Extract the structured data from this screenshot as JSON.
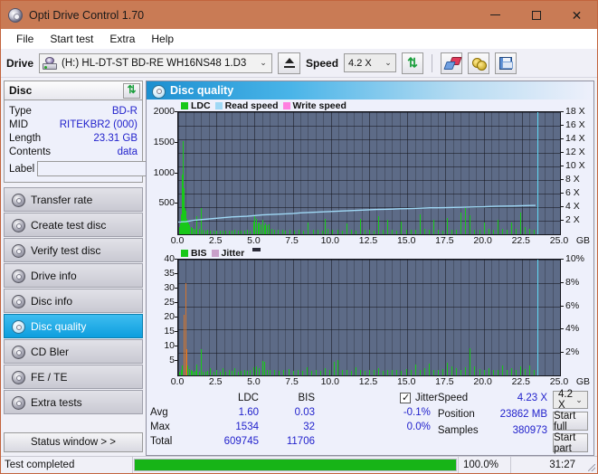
{
  "window": {
    "title": "Opti Drive Control 1.70",
    "icon": "disc-icon",
    "minimize": "minimize-icon",
    "maximize": "maximize-icon",
    "close": "close-icon"
  },
  "menu": [
    "File",
    "Start test",
    "Extra",
    "Help"
  ],
  "toolbar": {
    "drive_label": "Drive",
    "drive_value": "(H:)  HL-DT-ST BD-RE  WH16NS48 1.D3",
    "eject": "eject-icon",
    "speed_label": "Speed",
    "speed_value": "4.2 X",
    "refresh": "refresh-icon",
    "erase": "eraser-icon",
    "tools": "tools-icon",
    "save": "save-icon"
  },
  "disc_panel": {
    "header": "Disc",
    "refresh": "refresh-icon",
    "rows": [
      {
        "key": "Type",
        "value": "BD-R"
      },
      {
        "key": "MID",
        "value": "RITEKBR2 (000)"
      },
      {
        "key": "Length",
        "value": "23.31 GB"
      },
      {
        "key": "Contents",
        "value": "data"
      }
    ],
    "label_key": "Label",
    "label_value": "",
    "label_btn": "cd-icon"
  },
  "sidebar": {
    "items": [
      {
        "label": "Transfer rate",
        "active": false
      },
      {
        "label": "Create test disc",
        "active": false
      },
      {
        "label": "Verify test disc",
        "active": false
      },
      {
        "label": "Drive info",
        "active": false
      },
      {
        "label": "Disc info",
        "active": false
      },
      {
        "label": "Disc quality",
        "active": true
      },
      {
        "label": "CD Bler",
        "active": false
      },
      {
        "label": "FE / TE",
        "active": false
      },
      {
        "label": "Extra tests",
        "active": false
      }
    ],
    "status_window": "Status window > >"
  },
  "main": {
    "title": "Disc quality",
    "icon": "disc-quality-icon"
  },
  "stats": {
    "col_headers": [
      "LDC",
      "BIS"
    ],
    "rows": [
      {
        "label": "Avg",
        "ldc": "1.60",
        "bis": "0.03"
      },
      {
        "label": "Max",
        "ldc": "1534",
        "bis": "32"
      },
      {
        "label": "Total",
        "ldc": "609745",
        "bis": "11706"
      }
    ],
    "jitter_label": "Jitter",
    "jitter_checked": true,
    "jitter_avg": "-0.1%",
    "jitter_max": "0.0%",
    "speed_label": "Speed",
    "speed_value": "4.23 X",
    "position_label": "Position",
    "position_value": "23862 MB",
    "samples_label": "Samples",
    "samples_value": "380973",
    "speed_select": "4.2 X",
    "start_full": "Start full",
    "start_part": "Start part"
  },
  "statusbar": {
    "message": "Test completed",
    "percent": "100.0%",
    "percent_value": 100,
    "time": "31:27"
  },
  "colors": {
    "titlebar": "#c97b55",
    "accent": "#0d9ede",
    "ldc_green": "#18c818",
    "read_speed": "#9fd8f5",
    "write_speed": "#ff7fe0",
    "jitter": "#c9a0c9",
    "value_blue": "#2222cc",
    "progress_green": "#17b417",
    "plot_bg": "#5d6b87"
  },
  "chart_data": [
    {
      "id": "ldc-chart",
      "type": "bar",
      "title": "Disc quality",
      "legend": [
        {
          "label": "LDC",
          "color": "#18c818"
        },
        {
          "label": "Read speed",
          "color": "#9fd8f5"
        },
        {
          "label": "Write speed",
          "color": "#ff7fe0"
        }
      ],
      "legend_position": "top-left",
      "xlabel": "GB",
      "ylabel": "LDC",
      "y2label": "X",
      "xlim": [
        0,
        25.0
      ],
      "ylim": [
        0,
        2000
      ],
      "y2lim": [
        0,
        18
      ],
      "xticks": [
        0.0,
        2.5,
        5.0,
        7.5,
        10.0,
        12.5,
        15.0,
        17.5,
        20.0,
        22.5,
        25.0
      ],
      "xtick_labels": [
        "0.0",
        "2.5",
        "5.0",
        "7.5",
        "10.0",
        "12.5",
        "15.0",
        "17.5",
        "20.0",
        "22.5",
        "25.0"
      ],
      "yticks": [
        500,
        1000,
        1500,
        2000
      ],
      "ytick_labels": [
        "500",
        "1000",
        "1500",
        "2000"
      ],
      "y2ticks": [
        2,
        4,
        6,
        8,
        10,
        12,
        14,
        16,
        18
      ],
      "y2tick_labels": [
        "2 X",
        "4 X",
        "6 X",
        "8 X",
        "10 X",
        "12 X",
        "14 X",
        "16 X",
        "18 X"
      ],
      "grid": true,
      "cursor_x": 23.5,
      "series": [
        {
          "name": "LDC",
          "color": "#18c818",
          "type": "bar",
          "x": [
            0.05,
            0.1,
            0.15,
            0.2,
            0.25,
            0.3,
            0.35,
            0.4,
            0.45,
            0.5,
            0.55,
            0.6,
            0.65,
            0.7,
            0.8,
            0.9,
            1.0,
            1.1,
            1.2,
            1.35,
            1.5,
            1.6,
            1.75,
            1.9,
            2.1,
            2.3,
            2.5,
            2.7,
            2.9,
            3.1,
            3.3,
            3.5,
            3.7,
            3.9,
            4.1,
            4.3,
            4.5,
            4.7,
            4.9,
            5.0,
            5.1,
            5.2,
            5.3,
            5.4,
            5.5,
            5.6,
            5.7,
            5.8,
            5.9,
            6.1,
            6.3,
            6.5,
            6.8,
            7.0,
            7.3,
            7.6,
            7.9,
            8.2,
            8.5,
            8.8,
            9.1,
            9.4,
            9.6,
            9.8,
            10.1,
            10.4,
            10.7,
            11.0,
            11.3,
            11.6,
            11.9,
            12.2,
            12.5,
            12.8,
            13.1,
            13.4,
            13.7,
            14.0,
            14.3,
            14.6,
            14.9,
            15.2,
            15.5,
            15.8,
            16.1,
            16.4,
            16.7,
            17.0,
            17.3,
            17.6,
            17.9,
            18.2,
            18.5,
            18.8,
            19.1,
            19.4,
            19.7,
            20.0,
            20.3,
            20.6,
            20.9,
            21.2,
            21.5,
            21.8,
            22.1,
            22.4,
            22.7,
            23.0,
            23.3
          ],
          "values": [
            120,
            180,
            260,
            330,
            980,
            1534,
            760,
            430,
            390,
            330,
            260,
            210,
            180,
            150,
            130,
            110,
            90,
            85,
            300,
            95,
            430,
            80,
            70,
            75,
            70,
            65,
            70,
            60,
            70,
            65,
            70,
            60,
            75,
            65,
            70,
            60,
            75,
            65,
            220,
            310,
            260,
            180,
            200,
            170,
            240,
            155,
            190,
            150,
            175,
            95,
            85,
            80,
            75,
            70,
            80,
            70,
            75,
            70,
            200,
            85,
            78,
            72,
            260,
            88,
            80,
            75,
            70,
            180,
            80,
            70,
            260,
            82,
            78,
            72,
            300,
            80,
            250,
            75,
            70,
            210,
            82,
            80,
            75,
            330,
            88,
            80,
            240,
            75,
            70,
            280,
            82,
            78,
            360,
            430,
            310,
            85,
            80,
            200,
            95,
            85,
            250,
            90,
            80,
            200,
            95,
            360,
            120,
            95,
            85
          ]
        },
        {
          "name": "Read speed",
          "color": "#9fd8f5",
          "type": "line",
          "x": [
            0.0,
            0.5,
            1.0,
            1.5,
            2.0,
            2.5,
            3.0,
            3.5,
            4.0,
            4.5,
            5.0,
            5.5,
            6.0,
            6.5,
            7.0,
            7.5,
            8.0,
            8.5,
            9.0,
            9.5,
            10.0,
            10.5,
            11.0,
            11.5,
            12.0,
            12.5,
            13.0,
            13.5,
            14.0,
            14.5,
            15.0,
            15.5,
            16.0,
            16.5,
            17.0,
            17.5,
            18.0,
            18.5,
            19.0,
            19.5,
            20.0,
            20.5,
            21.0,
            21.5,
            22.0,
            22.5,
            23.0,
            23.4
          ],
          "values": [
            1.85,
            1.9,
            2.1,
            2.2,
            2.3,
            2.4,
            2.5,
            2.6,
            2.65,
            2.7,
            2.8,
            2.9,
            2.95,
            3.0,
            3.05,
            3.1,
            3.2,
            3.25,
            3.3,
            3.35,
            3.4,
            3.45,
            3.5,
            3.55,
            3.6,
            3.65,
            3.7,
            3.72,
            3.75,
            3.8,
            3.82,
            3.85,
            3.9,
            3.95,
            3.95,
            3.97,
            4.0,
            4.02,
            4.05,
            4.08,
            4.1,
            4.15,
            4.18,
            4.2,
            4.22,
            4.25,
            4.28,
            4.3
          ]
        },
        {
          "name": "Write speed",
          "color": "#ff7fe0",
          "type": "line",
          "x": [],
          "values": []
        }
      ]
    },
    {
      "id": "bis-jitter-chart",
      "type": "bar",
      "legend": [
        {
          "label": "BIS",
          "color": "#18c818"
        },
        {
          "label": "Jitter",
          "color": "#c9a0c9"
        }
      ],
      "legend_position": "top-left",
      "xlabel": "GB",
      "ylabel": "BIS",
      "y2label": "%",
      "xlim": [
        0,
        25.0
      ],
      "ylim": [
        0,
        40
      ],
      "y2lim": [
        0,
        10
      ],
      "xticks": [
        0.0,
        2.5,
        5.0,
        7.5,
        10.0,
        12.5,
        15.0,
        17.5,
        20.0,
        22.5,
        25.0
      ],
      "xtick_labels": [
        "0.0",
        "2.5",
        "5.0",
        "7.5",
        "10.0",
        "12.5",
        "15.0",
        "17.5",
        "20.0",
        "22.5",
        "25.0"
      ],
      "yticks": [
        5,
        10,
        15,
        20,
        25,
        30,
        35,
        40
      ],
      "ytick_labels": [
        "5",
        "10",
        "15",
        "20",
        "25",
        "30",
        "35",
        "40"
      ],
      "y2ticks": [
        2,
        4,
        6,
        8,
        10
      ],
      "y2tick_labels": [
        "2%",
        "4%",
        "6%",
        "8%",
        "10%"
      ],
      "grid": true,
      "cursor_x": 23.5,
      "series": [
        {
          "name": "BIS",
          "color": "#18c818",
          "type": "bar",
          "x": [
            0.05,
            0.15,
            0.25,
            0.35,
            0.45,
            0.5,
            0.55,
            0.6,
            0.7,
            0.8,
            0.9,
            1.0,
            1.1,
            1.2,
            1.35,
            1.5,
            1.6,
            1.75,
            1.9,
            2.1,
            2.3,
            2.5,
            2.7,
            2.9,
            3.1,
            3.3,
            3.5,
            3.7,
            3.9,
            4.1,
            4.3,
            4.5,
            4.7,
            4.9,
            5.1,
            5.3,
            5.5,
            5.6,
            5.8,
            6.0,
            6.3,
            6.6,
            6.9,
            7.2,
            7.5,
            7.8,
            8.1,
            8.4,
            8.7,
            9.0,
            9.3,
            9.6,
            9.9,
            10.2,
            10.45,
            10.7,
            11.0,
            11.3,
            11.6,
            11.9,
            12.2,
            12.5,
            12.8,
            13.1,
            13.4,
            13.7,
            14.0,
            14.3,
            14.6,
            14.9,
            15.2,
            15.5,
            15.8,
            16.1,
            16.4,
            16.7,
            17.0,
            17.3,
            17.6,
            17.9,
            18.2,
            18.5,
            18.8,
            19.1,
            19.4,
            19.7,
            20.0,
            20.3,
            20.6,
            20.9,
            21.2,
            21.5,
            21.8,
            22.1,
            22.4,
            22.7,
            23.0,
            23.3
          ],
          "values": [
            1.2,
            2.0,
            3.5,
            5.0,
            7.0,
            6.5,
            5.0,
            3.5,
            2.2,
            1.8,
            1.5,
            1.2,
            1.5,
            3.8,
            1.4,
            9.2,
            1.3,
            1.2,
            1.5,
            2.4,
            1.3,
            2.0,
            1.4,
            2.6,
            1.3,
            1.8,
            1.5,
            2.5,
            1.4,
            1.6,
            2.0,
            1.5,
            1.8,
            2.8,
            3.2,
            2.4,
            5.0,
            4.6,
            2.0,
            1.8,
            2.0,
            1.5,
            1.8,
            2.2,
            1.6,
            1.9,
            1.5,
            2.8,
            1.7,
            2.0,
            1.6,
            2.4,
            1.8,
            4.6,
            5.2,
            2.0,
            1.8,
            1.6,
            2.8,
            1.9,
            1.7,
            2.0,
            1.8,
            2.6,
            1.7,
            1.9,
            1.8,
            2.0,
            1.7,
            2.2,
            1.8,
            3.8,
            2.0,
            2.6,
            4.2,
            2.0,
            1.8,
            2.2,
            4.4,
            3.0,
            2.4,
            2.0,
            2.8,
            9.4,
            3.2,
            2.2,
            2.0,
            2.6,
            2.0,
            1.8,
            3.4,
            2.0,
            2.4,
            2.0,
            3.0,
            2.2,
            3.4,
            2.0
          ]
        },
        {
          "name": "Jitter",
          "color": "#c9a0c9",
          "type": "line",
          "x": [
            0.35,
            0.45,
            0.5,
            0.55
          ],
          "values": [
            20.8,
            32.0,
            26.0,
            9.0
          ]
        }
      ]
    }
  ]
}
